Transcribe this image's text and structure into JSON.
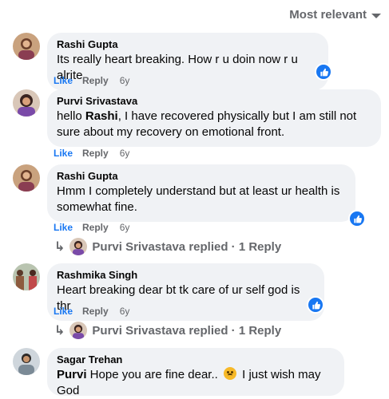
{
  "sort": {
    "label": "Most relevant"
  },
  "labels": {
    "like": "Like",
    "reply": "Reply"
  },
  "comments": [
    {
      "author": "Rashi Gupta",
      "text": "Its really heart breaking. How r u doin now r u alrite",
      "time": "6y",
      "reaction": "like-icon"
    },
    {
      "author": "Purvi Srivastava",
      "text_prefix": "hello ",
      "mention": "Rashi",
      "text": ", I have recovered physically but I am still not sure about my recovery on emotional front.",
      "time": "6y"
    },
    {
      "author": "Rashi Gupta",
      "text": "Hmm I completely understand but at least ur health is somewhat fine.",
      "time": "6y",
      "reaction": "like-icon",
      "replies_summary": "Purvi Srivastava replied · 1 Reply"
    },
    {
      "author": "Rashmika Singh",
      "text": "Heart breaking dear bt tk care of ur self god is thr",
      "time": "6y",
      "reaction": "like-icon",
      "replies_summary": "Purvi Srivastava replied · 1 Reply"
    },
    {
      "author": "Sagar Trehan",
      "mention": "Purvi",
      "text_mid": " Hope you are fine dear.. ",
      "emoji": "sad-face-emoji",
      "text": " I just wish may God"
    }
  ],
  "colors": {
    "accent": "#1877f2",
    "bubble": "#f0f2f5",
    "muted": "#65676b"
  }
}
